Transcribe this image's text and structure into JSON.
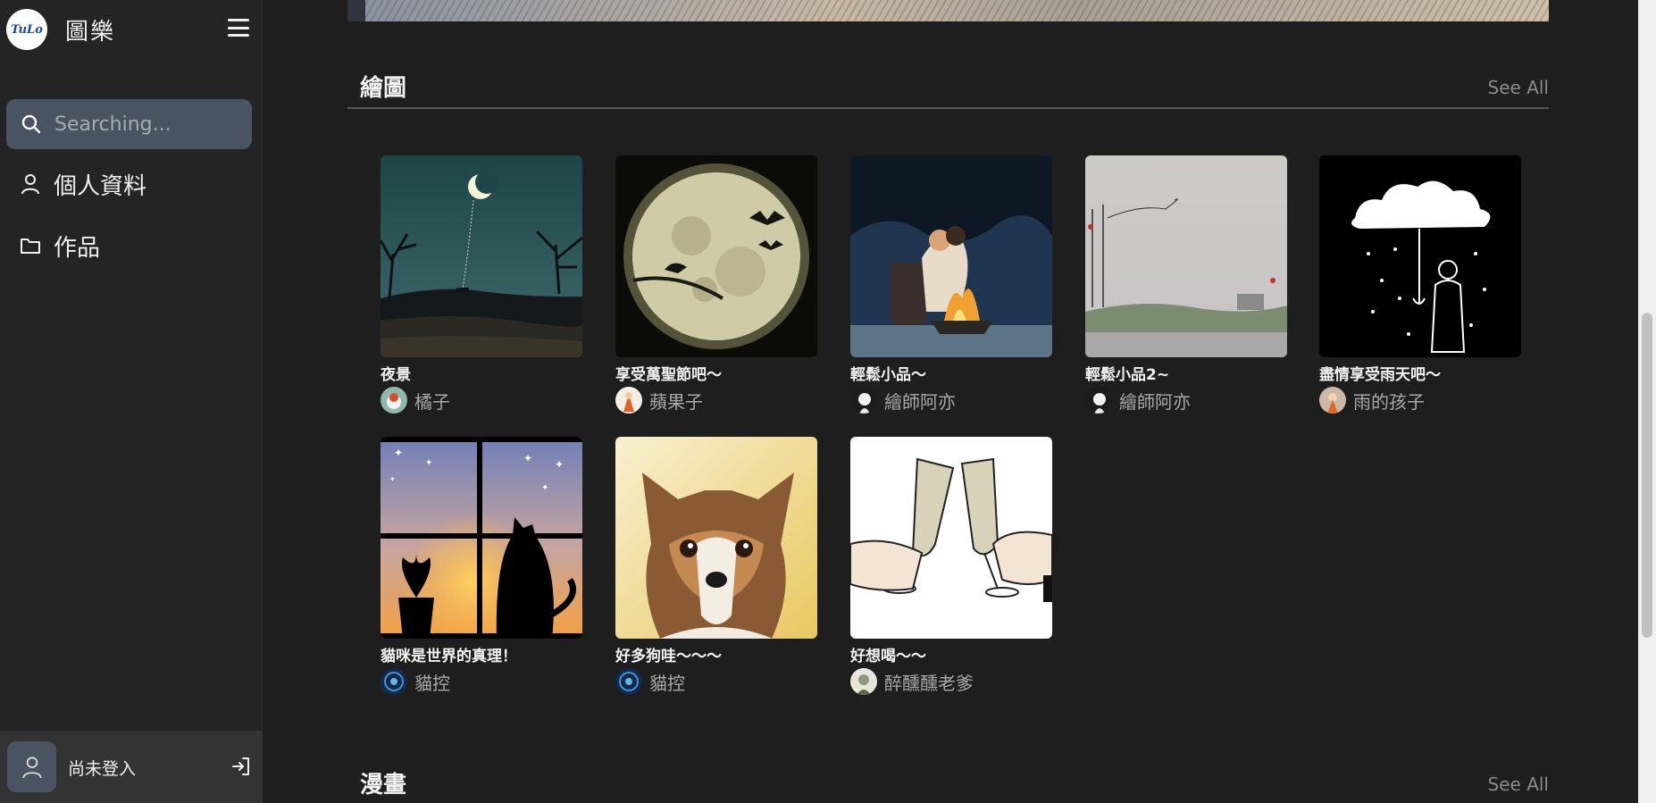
{
  "app": {
    "logo_text": "TuLo",
    "name": "圖樂"
  },
  "search": {
    "placeholder": "Searching..."
  },
  "nav": {
    "profile_label": "個人資料",
    "works_label": "作品"
  },
  "user": {
    "status": "尚未登入"
  },
  "sections": [
    {
      "title": "繪圖",
      "see_all": "See All",
      "cards": [
        {
          "title": "夜景",
          "author": "橘子"
        },
        {
          "title": "享受萬聖節吧～",
          "author": "蘋果子"
        },
        {
          "title": "輕鬆小品～",
          "author": "繪師阿亦"
        },
        {
          "title": "輕鬆小品2~",
          "author": "繪師阿亦"
        },
        {
          "title": "盡情享受雨天吧～",
          "author": "雨的孩子"
        },
        {
          "title": "貓咪是世界的真理！",
          "author": "貓控"
        },
        {
          "title": "好多狗哇～～～",
          "author": "貓控"
        },
        {
          "title": "好想喝～～",
          "author": "醉醺醺老爹"
        }
      ]
    },
    {
      "title": "漫畫",
      "see_all": "See All"
    }
  ]
}
